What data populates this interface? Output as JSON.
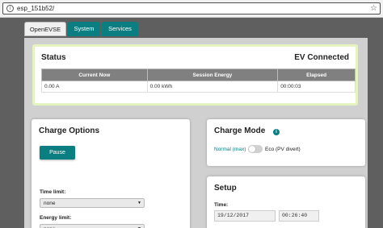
{
  "browser": {
    "url": "esp_151b52/",
    "info_glyph": "i",
    "star_glyph": "☆"
  },
  "tabs": [
    {
      "label": "OpenEVSE"
    },
    {
      "label": "System"
    },
    {
      "label": "Services"
    }
  ],
  "colors": {
    "accent": "#0a7e80",
    "status_border": "#e4f3c0"
  },
  "status": {
    "title": "Status",
    "state": "EV Connected",
    "headers": [
      "Current Now",
      "Session Energy",
      "Elapsed"
    ],
    "values": [
      "0.00 A",
      "0.00 kWh",
      "00:00:03"
    ]
  },
  "charge_options": {
    "title": "Charge Options",
    "pause_label": "Pause",
    "time_limit_label": "Time limit:",
    "time_limit_value": "none",
    "energy_limit_label": "Energy limit:",
    "energy_limit_value": "none",
    "caret_glyph": "▼"
  },
  "charge_mode": {
    "title": "Charge Mode",
    "help_glyph": "i",
    "normal_label": "Normal (max)",
    "eco_label": "Eco (PV divert)",
    "eco_enabled": false
  },
  "setup": {
    "title": "Setup",
    "time_label": "Time:",
    "date_value": "19/12/2017",
    "clock_value": "00:26:40"
  }
}
